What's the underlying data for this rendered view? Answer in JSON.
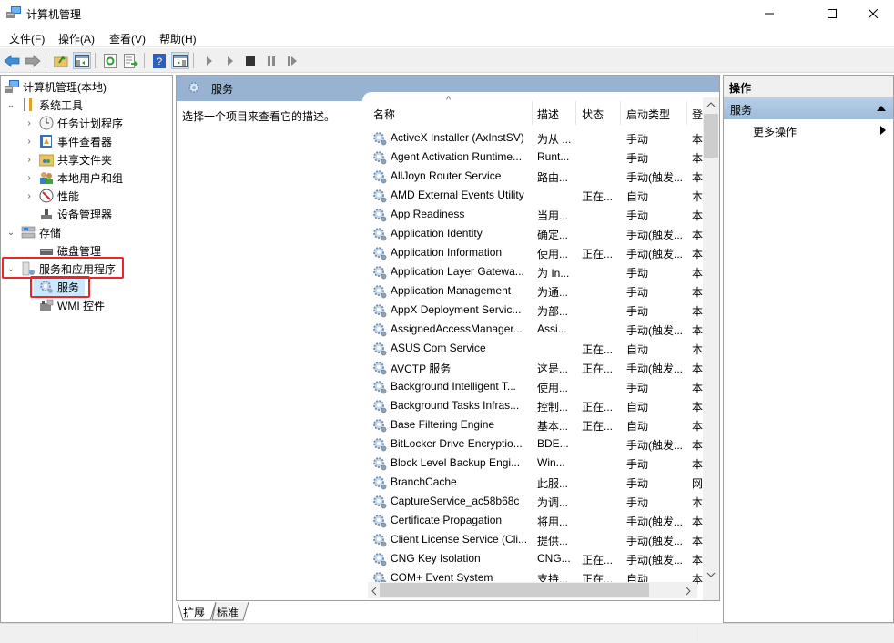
{
  "window": {
    "title": "计算机管理",
    "controls": {
      "minimize": "minimize-icon",
      "maximize": "maximize-icon",
      "close": "close-icon"
    }
  },
  "menu": [
    "文件(F)",
    "操作(A)",
    "查看(V)",
    "帮助(H)"
  ],
  "toolbar": {
    "icons": [
      "back-arrow-icon",
      "forward-arrow-icon",
      "up-folder-icon",
      "show-hide-tree-icon",
      "refresh-icon",
      "export-list-icon",
      "help-icon",
      "show-hide-action-pane-icon",
      "start-service-icon",
      "start-service-alt-icon",
      "stop-service-icon",
      "pause-service-icon",
      "resume-service-icon"
    ]
  },
  "tree": {
    "root": "计算机管理(本地)",
    "items": [
      {
        "label": "系统工具",
        "level": 1,
        "expanded": true
      },
      {
        "label": "任务计划程序",
        "level": 2,
        "expandable": true
      },
      {
        "label": "事件查看器",
        "level": 2,
        "expandable": true
      },
      {
        "label": "共享文件夹",
        "level": 2,
        "expandable": true
      },
      {
        "label": "本地用户和组",
        "level": 2,
        "expandable": true
      },
      {
        "label": "性能",
        "level": 2,
        "expandable": true
      },
      {
        "label": "设备管理器",
        "level": 2,
        "expandable": false
      },
      {
        "label": "存储",
        "level": 1,
        "expanded": true
      },
      {
        "label": "磁盘管理",
        "level": 2,
        "expandable": false
      },
      {
        "label": "服务和应用程序",
        "level": 1,
        "expanded": true,
        "highlighted": true
      },
      {
        "label": "服务",
        "level": 2,
        "selected": true,
        "highlighted": true
      },
      {
        "label": "WMI 控件",
        "level": 2,
        "expandable": false
      }
    ]
  },
  "center": {
    "title": "服务",
    "description_hint": "选择一个项目来查看它的描述。",
    "columns": [
      "名称",
      "描述",
      "状态",
      "启动类型",
      "登"
    ],
    "sort_indicator": "^",
    "services": [
      {
        "name": "ActiveX Installer (AxInstSV)",
        "desc": "为从 ...",
        "status": "",
        "startup": "手动",
        "logon": "本"
      },
      {
        "name": "Agent Activation Runtime...",
        "desc": "Runt...",
        "status": "",
        "startup": "手动",
        "logon": "本"
      },
      {
        "name": "AllJoyn Router Service",
        "desc": "路由...",
        "status": "",
        "startup": "手动(触发...",
        "logon": "本"
      },
      {
        "name": "AMD External Events Utility",
        "desc": "",
        "status": "正在...",
        "startup": "自动",
        "logon": "本"
      },
      {
        "name": "App Readiness",
        "desc": "当用...",
        "status": "",
        "startup": "手动",
        "logon": "本"
      },
      {
        "name": "Application Identity",
        "desc": "确定...",
        "status": "",
        "startup": "手动(触发...",
        "logon": "本"
      },
      {
        "name": "Application Information",
        "desc": "使用...",
        "status": "正在...",
        "startup": "手动(触发...",
        "logon": "本"
      },
      {
        "name": "Application Layer Gatewa...",
        "desc": "为 In...",
        "status": "",
        "startup": "手动",
        "logon": "本"
      },
      {
        "name": "Application Management",
        "desc": "为通...",
        "status": "",
        "startup": "手动",
        "logon": "本"
      },
      {
        "name": "AppX Deployment Servic...",
        "desc": "为部...",
        "status": "",
        "startup": "手动",
        "logon": "本"
      },
      {
        "name": "AssignedAccessManager...",
        "desc": "Assi...",
        "status": "",
        "startup": "手动(触发...",
        "logon": "本"
      },
      {
        "name": "ASUS Com Service",
        "desc": "",
        "status": "正在...",
        "startup": "自动",
        "logon": "本"
      },
      {
        "name": "AVCTP 服务",
        "desc": "这是...",
        "status": "正在...",
        "startup": "手动(触发...",
        "logon": "本"
      },
      {
        "name": "Background Intelligent T...",
        "desc": "使用...",
        "status": "",
        "startup": "手动",
        "logon": "本"
      },
      {
        "name": "Background Tasks Infras...",
        "desc": "控制...",
        "status": "正在...",
        "startup": "自动",
        "logon": "本"
      },
      {
        "name": "Base Filtering Engine",
        "desc": "基本...",
        "status": "正在...",
        "startup": "自动",
        "logon": "本"
      },
      {
        "name": "BitLocker Drive Encryptio...",
        "desc": "BDE...",
        "status": "",
        "startup": "手动(触发...",
        "logon": "本"
      },
      {
        "name": "Block Level Backup Engi...",
        "desc": "Win...",
        "status": "",
        "startup": "手动",
        "logon": "本"
      },
      {
        "name": "BranchCache",
        "desc": "此服...",
        "status": "",
        "startup": "手动",
        "logon": "网"
      },
      {
        "name": "CaptureService_ac58b68c",
        "desc": "为调...",
        "status": "",
        "startup": "手动",
        "logon": "本"
      },
      {
        "name": "Certificate Propagation",
        "desc": "将用...",
        "status": "",
        "startup": "手动(触发...",
        "logon": "本"
      },
      {
        "name": "Client License Service (Cli...",
        "desc": "提供...",
        "status": "",
        "startup": "手动(触发...",
        "logon": "本"
      },
      {
        "name": "CNG Key Isolation",
        "desc": "CNG...",
        "status": "正在...",
        "startup": "手动(触发...",
        "logon": "本"
      },
      {
        "name": "COM+ Event System",
        "desc": "支持...",
        "status": "正在...",
        "startup": "自动",
        "logon": "本"
      }
    ],
    "tabs": [
      "扩展",
      "标准"
    ],
    "active_tab": "扩展"
  },
  "actions": {
    "header": "操作",
    "section": "服务",
    "items": [
      "更多操作"
    ]
  },
  "colors": {
    "header_band": "#97b3d1",
    "highlight_box": "#e8262c",
    "selected_bg": "#cce8ff"
  }
}
